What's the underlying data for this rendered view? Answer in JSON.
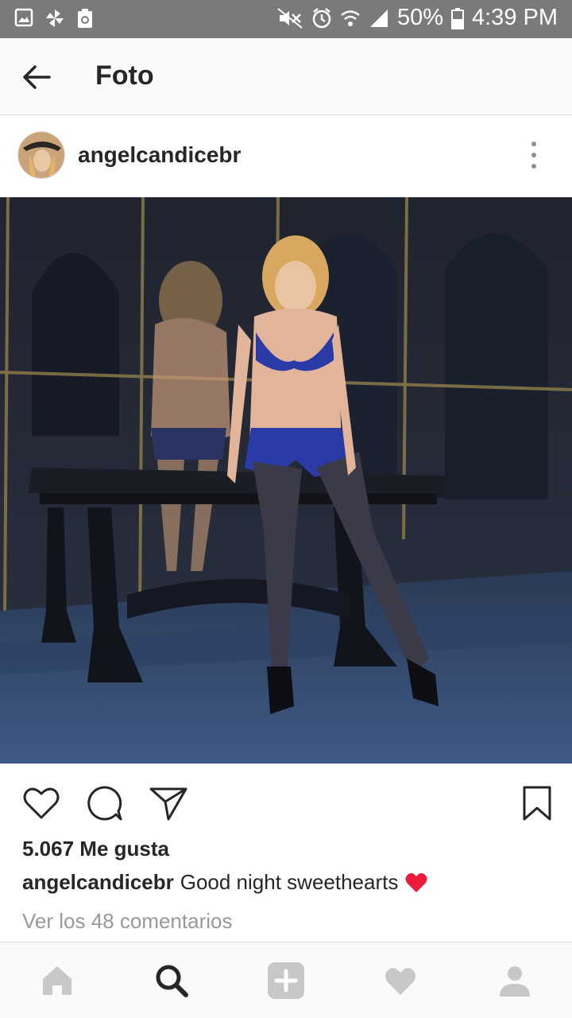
{
  "status_bar": {
    "battery_percent": "50%",
    "time": "4:39 PM",
    "left_icons": [
      "image-icon",
      "pinwheel-icon",
      "recycle-clipboard-icon"
    ],
    "right_icons": [
      "mute-icon",
      "alarm-icon",
      "wifi-icon",
      "signal-icon",
      "battery-icon"
    ]
  },
  "app_bar": {
    "title": "Foto",
    "back_icon": "arrow-left-icon"
  },
  "post": {
    "username": "angelcandicebr",
    "likes_text": "5.067 Me gusta",
    "caption_user": "angelcandicebr",
    "caption_text": "Good night sweethearts",
    "caption_emoji": "red-heart-emoji",
    "view_comments": "Ver los 48 comentarios"
  },
  "actions": [
    "heart-icon",
    "comment-icon",
    "share-icon",
    "bookmark-icon"
  ],
  "bottom_nav": [
    "home-icon",
    "search-icon",
    "add-post-icon",
    "activity-heart-icon",
    "profile-icon"
  ],
  "colors": {
    "status_bar": "#7a7a7a",
    "text": "#262626",
    "muted": "#999999",
    "nav_inactive": "#c7c7c7",
    "heart_red": "#ed1c3a"
  }
}
